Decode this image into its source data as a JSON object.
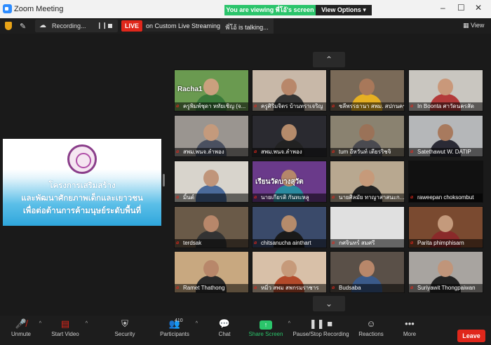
{
  "window": {
    "title": "Zoom Meeting",
    "viewing_banner": "You are viewing พี่โอ้'s screen",
    "view_options": "View Options ▾",
    "minimize_icon": "minimize-icon",
    "maximize_icon": "maximize-icon",
    "close_icon": "close-icon"
  },
  "topbar": {
    "recording_label": "Recording...",
    "live_label": "LIVE",
    "stream_label": "on Custom Live Streaming Se",
    "talking": "พี่โอ้ is  talking...",
    "view_label": "View"
  },
  "shared_screen": {
    "line1": "โครงการเสริมสร้าง",
    "line2": "และพัฒนาศักยภาพเด็กและเยาวชน",
    "line3": "เพื่อต่อต้านการค้ามนุษย์ระดับพื้นที่",
    "theme_colors": {
      "top": "#ffffff",
      "bottom": "#2fa6dc",
      "seal": "#8a3e8a"
    }
  },
  "participants": [
    {
      "name": "ครูพิมพ์ชุดา หทัยเชิญ (จ...",
      "bg": "#6a9a50",
      "skin": "#caa07e",
      "shirt": "#3a7a3a",
      "overlay": "Racha1"
    },
    {
      "name": "ครูศิริมจิตร บ้านทราเจริญ",
      "bg": "#c8b8a8",
      "skin": "#b8876a",
      "shirt": "#333"
    },
    {
      "name": "ชลีพรรธานา สพม. สปกนคร...",
      "bg": "#7a6a58",
      "skin": "#a8785a",
      "shirt": "#e6b022"
    },
    {
      "name": "In Boonta ศาวัดนครสัด",
      "bg": "#c9c6c0",
      "skin": "#c9987a",
      "shirt": "#b33a3a"
    },
    {
      "name": "สพม.พนจ.ลำพอง",
      "bg": "#9a9590",
      "skin": "#c49a7c",
      "shirt": "#4a5060"
    },
    {
      "name": "สพม.พนจ.ลำพอง",
      "bg": "#2a2a30",
      "skin": "#b58b6b",
      "shirt": "#222"
    },
    {
      "name": "tum อีหวันท์ เตียรริชจิ",
      "bg": "#8a8270",
      "skin": "#9a7258",
      "shirt": "#4a4a50"
    },
    {
      "name": "Satethawut W. DATIP",
      "bg": "#b5b7b9",
      "skin": "#a87a5e",
      "shirt": "#2a2a35"
    },
    {
      "name": "มิ้นต์",
      "bg": "#d8d4cc",
      "skin": "#c0957a",
      "shirt": "#4a6a9a"
    },
    {
      "name": "นายเกียรติ กันทะหลู",
      "bg": "#6a3a8a",
      "skin": "#b5876a",
      "shirt": "#2a8aa0",
      "overlay": "เรียนวัดบางสุวัต"
    },
    {
      "name": "นายศิลมัย ทาญาสาสนะก...",
      "bg": "#b8a890",
      "skin": "#c69a7a",
      "shirt": "#222"
    },
    {
      "name": "raweepan choksombut",
      "bg": "#111111",
      "skin": "",
      "shirt": ""
    },
    {
      "name": "terdsak",
      "bg": "#6a5a48",
      "skin": "#b8876a",
      "shirt": "#333"
    },
    {
      "name": "chitsanucha ainthart",
      "bg": "#3a4a6a",
      "skin": "#b58b6b",
      "shirt": "#1a1a1a"
    },
    {
      "name": "กศจินทร์ สมศรี",
      "bg": "#e0e0e0",
      "skin": "",
      "shirt": ""
    },
    {
      "name": "Parita phimphisarn",
      "bg": "#7a4a30",
      "skin": "#c49a7c",
      "shirt": "#8a2a2a"
    },
    {
      "name": "Ramet Thathong",
      "bg": "#c8a880",
      "skin": "#b8876a",
      "shirt": "#2a2a2a"
    },
    {
      "name": "หมิ่ว สพม สพกรมราชาร",
      "bg": "#d8c0a8",
      "skin": "#c69a7a",
      "shirt": "#b34a2a"
    },
    {
      "name": "Budsaba",
      "bg": "#5a5048",
      "skin": "#b8876a",
      "shirt": "#3a5a8a"
    },
    {
      "name": "Suriyawit Thongpaiwan",
      "bg": "#a8a4a0",
      "skin": "#c0957a",
      "shirt": "#222"
    }
  ],
  "toolbar": {
    "unmute": "Unmute",
    "start_video": "Start Video",
    "security": "Security",
    "participants": "Participants",
    "participants_count": "410",
    "chat": "Chat",
    "share_screen": "Share Screen",
    "pause_recording": "Pause/Stop Recording",
    "reactions": "Reactions",
    "more": "More",
    "leave": "Leave"
  }
}
